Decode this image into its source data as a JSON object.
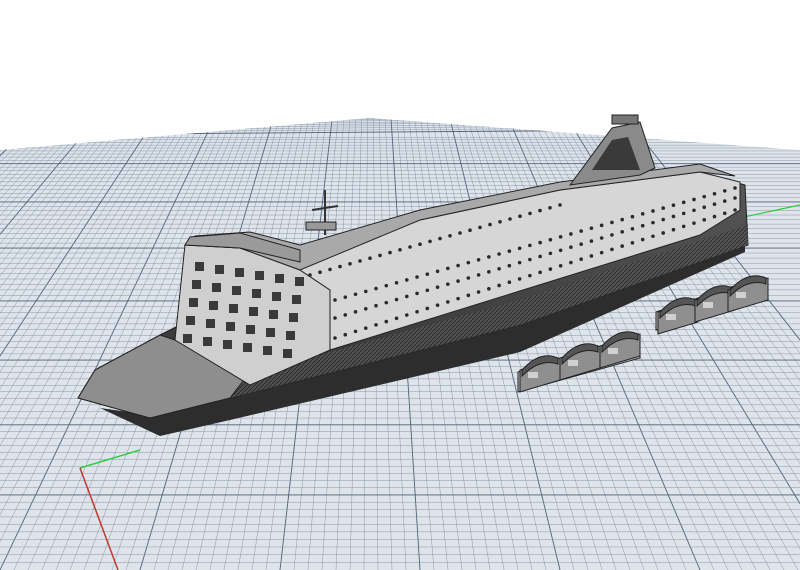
{
  "viewport": {
    "background": "#ffffff",
    "grid_fill": "#dfe4ea",
    "grid_line": "#7e8fa3",
    "grid_major_line": "#4f6178",
    "axis_x_color": "#c0392b",
    "axis_y_color": "#2ecc40"
  },
  "model": {
    "hull_color": "#6f6f6f",
    "hull_dark": "#3d3d3d",
    "superstructure_color": "#d2d2d2",
    "window_color": "#2a2a2a",
    "lifeboat_count": 6
  }
}
